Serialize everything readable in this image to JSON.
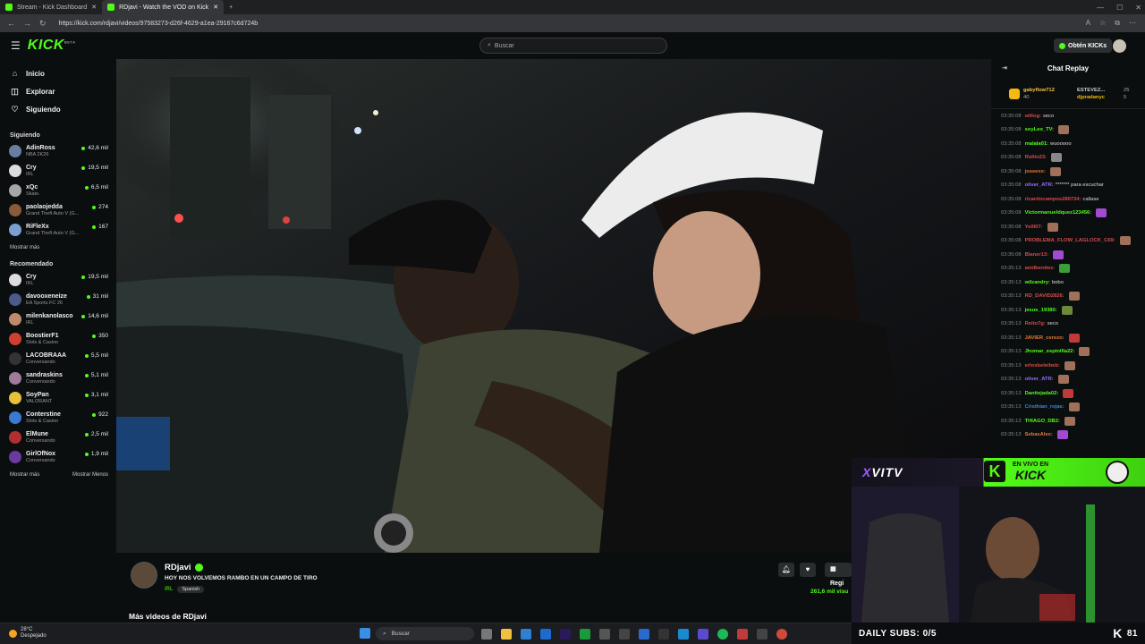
{
  "browser": {
    "tabs": [
      {
        "label": "Stream - Kick Dashboard",
        "active": false
      },
      {
        "label": "RDjavi - Watch the VOD on Kick",
        "active": true
      }
    ],
    "url": "https://kick.com/rdjavi/videos/97583273-d26f-4629-a1ea-29167c6d724b"
  },
  "header": {
    "search_placeholder": "Buscar",
    "get_kicks_label": "Obtén KICKs"
  },
  "sidebar": {
    "nav": [
      {
        "label": "Inicio",
        "icon": "home-icon"
      },
      {
        "label": "Explorar",
        "icon": "compass-icon"
      },
      {
        "label": "Siguiendo",
        "icon": "heart-icon"
      }
    ],
    "following_title": "Siguiendo",
    "following": [
      {
        "name": "AdinRoss",
        "category": "NBA 2K26",
        "viewers": "42,6 mil",
        "color": "#6a7fa0"
      },
      {
        "name": "Cry",
        "category": "IRL",
        "viewers": "19,5 mil",
        "color": "#ddd"
      },
      {
        "name": "xQc",
        "category": "Skate.",
        "viewers": "6,5 mil",
        "color": "#a6a6a6"
      },
      {
        "name": "paolaojedda",
        "category": "Grand Theft Auto V (G...",
        "viewers": "274",
        "color": "#8a5a3a"
      },
      {
        "name": "RiFleXx",
        "category": "Grand Theft Auto V (G...",
        "viewers": "167",
        "color": "#7c9fd1"
      }
    ],
    "show_more_1": "Mostrar más",
    "recommended_title": "Recomendado",
    "recommended": [
      {
        "name": "Cry",
        "category": "IRL",
        "viewers": "19,5 mil",
        "color": "#ddd"
      },
      {
        "name": "davooxeneize",
        "category": "EA Sports FC 26",
        "viewers": "31 mil",
        "color": "#4a5a8a"
      },
      {
        "name": "milenkanolasco",
        "category": "IRL",
        "viewers": "14,6 mil",
        "color": "#c08a6a"
      },
      {
        "name": "BoostierF1",
        "category": "Slots & Casino",
        "viewers": "350",
        "color": "#d04030"
      },
      {
        "name": "LACOBRAAA",
        "category": "Conversando",
        "viewers": "5,5 mil",
        "color": "#333"
      },
      {
        "name": "sandraskins",
        "category": "Conversando",
        "viewers": "5,1 mil",
        "color": "#a07a9a"
      },
      {
        "name": "SoyPan",
        "category": "VALORANT",
        "viewers": "3,1 mil",
        "color": "#e6c23a"
      },
      {
        "name": "Conterstine",
        "category": "Slots & Casino",
        "viewers": "922",
        "color": "#3a7ad0"
      },
      {
        "name": "ElMune",
        "category": "Conversando",
        "viewers": "2,5 mil",
        "color": "#b03030"
      },
      {
        "name": "GirlOfNox",
        "category": "Conversando",
        "viewers": "1,9 mil",
        "color": "#6a3aa0"
      }
    ],
    "show_more_2": "Mostrar más",
    "show_less": "Mostrar Menos"
  },
  "stream": {
    "streamer": "RDjavi",
    "title": "HOY NOS VOLVEMOS RAMBO EN UN CAMPO DE TIRO",
    "category": "IRL",
    "language": "Spanish",
    "register_label": "Regi",
    "views": "261,6 mil visu",
    "more_videos": "Más videos de RDjavi"
  },
  "chat": {
    "title": "Chat Replay",
    "pinned": [
      {
        "user": "gabyflow712",
        "count": "40"
      },
      {
        "user": "ESTEVEZ...",
        "count": "25"
      },
      {
        "user": "djpradanyc",
        "count": "5"
      }
    ],
    "messages": [
      {
        "time": "03:35:08",
        "user": "wlilog:",
        "text": "seco",
        "color": "#d94a4a",
        "emote": ""
      },
      {
        "time": "03:35:08",
        "user": "soyLeo_TV:",
        "text": "",
        "color": "#53fc18",
        "emote": "#a0705a"
      },
      {
        "time": "03:35:08",
        "user": "malala01:",
        "text": "wuooooo",
        "color": "#53fc18",
        "emote": ""
      },
      {
        "time": "03:35:08",
        "user": "Rollin23:",
        "text": "",
        "color": "#d94a4a",
        "emote": "#888"
      },
      {
        "time": "03:35:08",
        "user": "joseexx:",
        "text": "",
        "color": "#e07a3a",
        "emote": "#a0705a"
      },
      {
        "time": "03:35:08",
        "user": "oliver_ATR:",
        "text": "******* para escuchar",
        "color": "#9b6cff",
        "emote": ""
      },
      {
        "time": "03:35:08",
        "user": "ricardocampos280734:",
        "text": "callase",
        "color": "#d94a4a",
        "emote": ""
      },
      {
        "time": "03:35:08",
        "user": "Victormanueldquez123456:",
        "text": "",
        "color": "#53fc18",
        "emote": "#a24ad0"
      },
      {
        "time": "03:35:08",
        "user": "Yelli07:",
        "text": "",
        "color": "#d94a4a",
        "emote": "#a0705a"
      },
      {
        "time": "03:35:08",
        "user": "PROBLEMA_FLOW_LAGLOCK_C69:",
        "text": "",
        "color": "#d94a4a",
        "emote": "#a0705a"
      },
      {
        "time": "03:35:08",
        "user": "Blaner13:",
        "text": "",
        "color": "#d94a4a",
        "emote": "#a24ad0"
      },
      {
        "time": "03:35:13",
        "user": "amilbenitez:",
        "text": "",
        "color": "#d94a4a",
        "emote": "#3aa03a"
      },
      {
        "time": "03:35:13",
        "user": "wilzandry:",
        "text": "bobo",
        "color": "#53fc18",
        "emote": ""
      },
      {
        "time": "03:35:13",
        "user": "RD_DAVID2826:",
        "text": "",
        "color": "#d94a4a",
        "emote": "#a0705a"
      },
      {
        "time": "03:35:13",
        "user": "jesus_19380:",
        "text": "",
        "color": "#53fc18",
        "emote": "#6a8a3a"
      },
      {
        "time": "03:35:13",
        "user": "Reito7g:",
        "text": "seco",
        "color": "#d94a4a",
        "emote": ""
      },
      {
        "time": "03:35:13",
        "user": "JAVIER_cerezo:",
        "text": "",
        "color": "#e07a3a",
        "emote": "#c03a3a"
      },
      {
        "time": "03:35:13",
        "user": "Jhomar_espinilla22:",
        "text": "",
        "color": "#53fc18",
        "emote": "#a0705a"
      },
      {
        "time": "03:35:13",
        "user": "erlosbeleibeb:",
        "text": "",
        "color": "#d94a4a",
        "emote": "#a0705a"
      },
      {
        "time": "03:35:13",
        "user": "oliver_ATR:",
        "text": "",
        "color": "#9b6cff",
        "emote": "#a0705a"
      },
      {
        "time": "03:35:13",
        "user": "Danitejada02:",
        "text": "",
        "color": "#53fc18",
        "emote": "#c03a3a"
      },
      {
        "time": "03:35:13",
        "user": "Cristhian_rojas:",
        "text": "",
        "color": "#3a8ad0",
        "emote": "#a0705a"
      },
      {
        "time": "03:35:13",
        "user": "THIAGO_DB2:",
        "text": "",
        "color": "#53fc18",
        "emote": "#a0705a"
      },
      {
        "time": "03:35:13",
        "user": "SebasAlex:",
        "text": "",
        "color": "#e07a3a",
        "emote": "#a24ad0"
      }
    ]
  },
  "overlay": {
    "brand_prefix": "X",
    "brand_rest": "VITV",
    "live_top": "EN VIVO EN",
    "live_bottom": "KICK",
    "k_badge": "K",
    "daily_subs": "DAILY SUBS: 0/5",
    "kick_count": "81"
  },
  "taskbar": {
    "temp": "28°C",
    "weather": "Despejado",
    "search_label": "Buscar"
  }
}
